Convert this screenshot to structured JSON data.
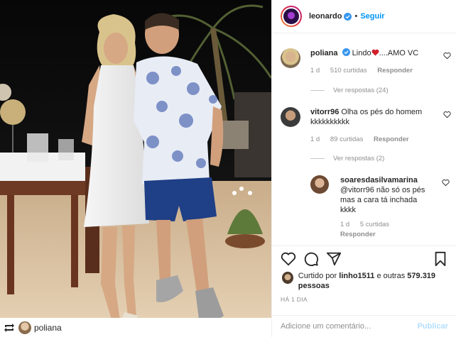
{
  "post": {
    "author": "leonardo",
    "separator": "•",
    "follow_label": "Seguir",
    "repost_user": "poliana"
  },
  "comments": [
    {
      "user": "poliana",
      "text_before": "Lindo",
      "text_after": "....AMO VC",
      "time": "1 d",
      "likes": "510 curtidas",
      "reply": "Responder",
      "view_replies": "Ver respostas (24)"
    },
    {
      "user": "vitorr96",
      "text": "Olha os pés do homem kkkkkkkkkk",
      "time": "1 d",
      "likes": "89 curtidas",
      "reply": "Responder",
      "view_replies": "Ver respostas (2)"
    }
  ],
  "nested_reply": {
    "user": "soaresdasilvamarina",
    "text": "@vitorr96 não só os pés mas a cara tá inchada kkkk",
    "time": "1 d",
    "likes": "5 curtidas",
    "reply": "Responder"
  },
  "likes_summary": {
    "prefix": "Curtido por",
    "user": "linho1511",
    "middle": "e outras",
    "count": "579.319",
    "suffix": "pessoas"
  },
  "timestamp": "HÁ 1 DIA",
  "add_comment": {
    "placeholder": "Adicione um comentário...",
    "publish_label": "Publicar"
  },
  "colors": {
    "accent": "#0095f6",
    "muted": "#8e8e8e",
    "publish_disabled": "#b2dffc",
    "heart_red": "#ed4956"
  },
  "icons": [
    "verified-icon",
    "heart-icon",
    "comment-icon",
    "share-icon",
    "bookmark-icon",
    "repost-icon"
  ]
}
